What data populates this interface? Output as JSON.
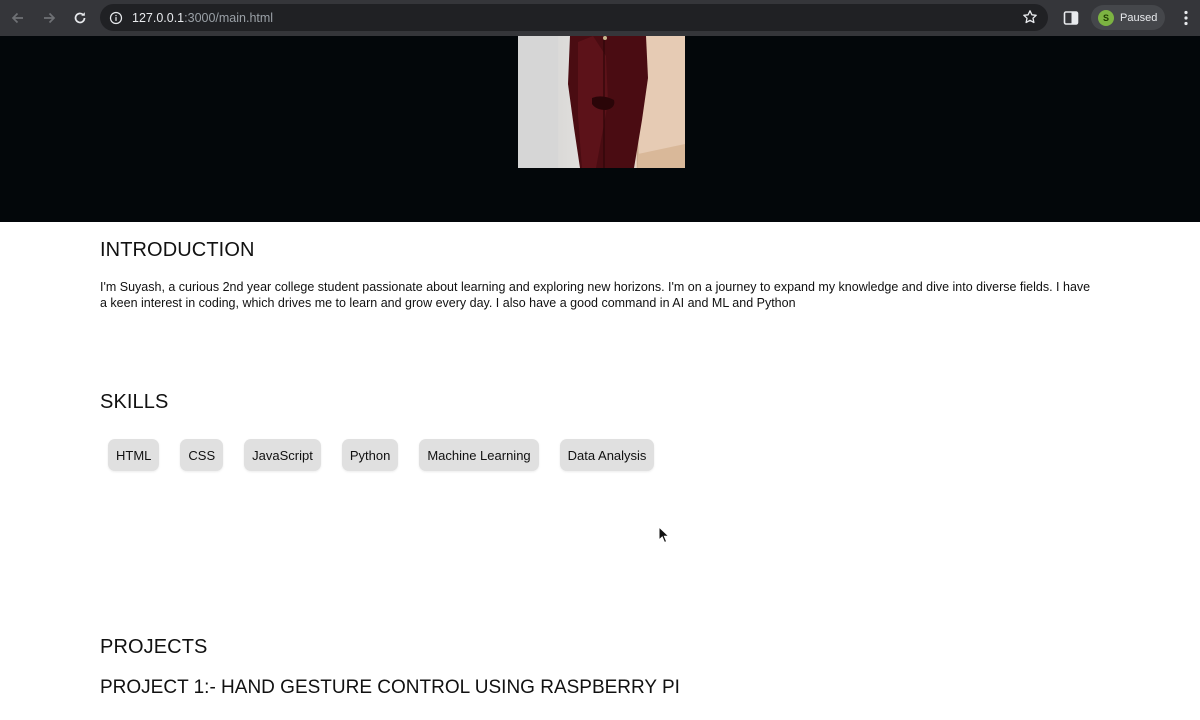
{
  "browser": {
    "url_host": "127.0.0.1",
    "url_path": ":3000/main.html",
    "profile_initial": "S",
    "profile_status": "Paused"
  },
  "intro": {
    "title": "INTRODUCTION",
    "text": "I'm Suyash, a curious 2nd year college student passionate about learning and exploring new horizons. I'm on a journey to expand my knowledge and dive into diverse fields. I have a keen interest in coding, which drives me to learn and grow every day. I also have a good command in AI and ML and Python"
  },
  "skills": {
    "title": "SKILLS",
    "items": [
      "HTML",
      "CSS",
      "JavaScript",
      "Python",
      "Machine Learning",
      "Data Analysis"
    ]
  },
  "projects": {
    "title": "PROJECTS",
    "first_project": "PROJECT 1:- HAND GESTURE CONTROL USING RASPBERRY PI"
  },
  "colors": {
    "hero_background": "#03070a",
    "chip_background": "#e0e0e0",
    "toolbar": "#35363a"
  }
}
